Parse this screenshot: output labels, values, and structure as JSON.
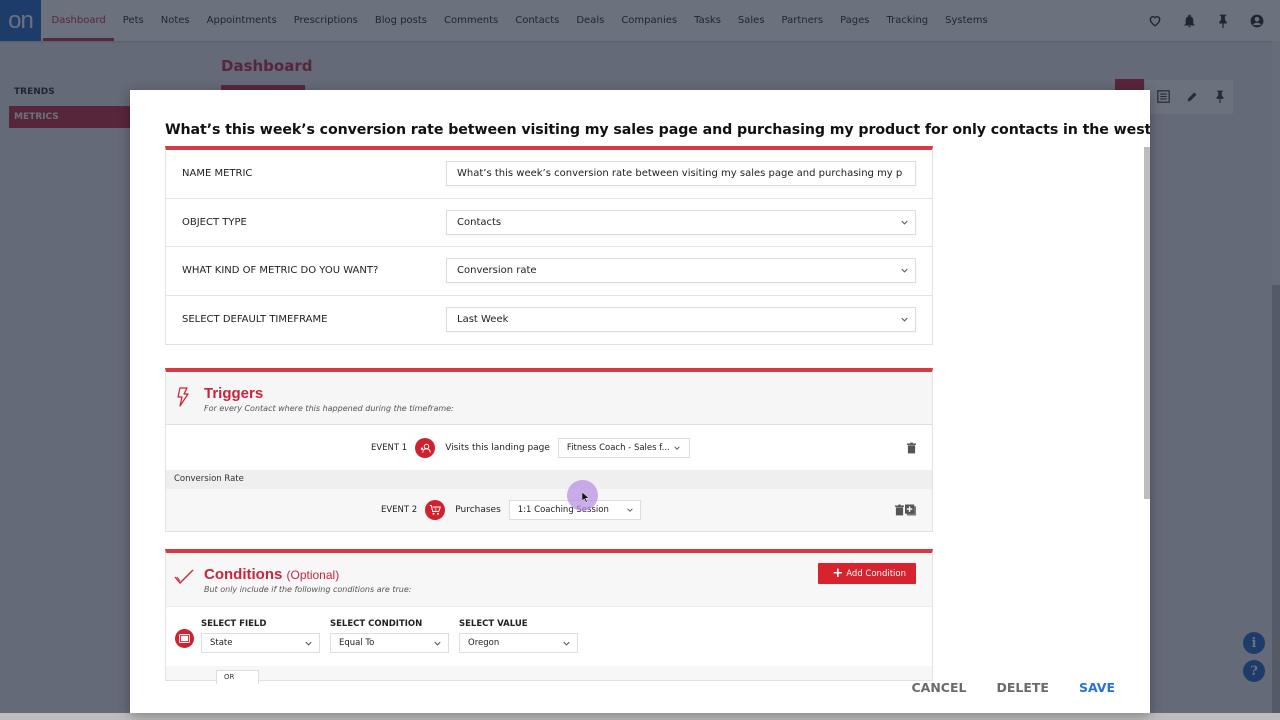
{
  "app": {
    "logo_text": "on",
    "nav": [
      {
        "label": "Dashboard",
        "active": true
      },
      {
        "label": "Pets"
      },
      {
        "label": "Notes"
      },
      {
        "label": "Appointments"
      },
      {
        "label": "Prescriptions"
      },
      {
        "label": "Blog posts"
      },
      {
        "label": "Comments"
      },
      {
        "label": "Contacts"
      },
      {
        "label": "Deals"
      },
      {
        "label": "Companies"
      },
      {
        "label": "Tasks"
      },
      {
        "label": "Sales"
      },
      {
        "label": "Partners"
      },
      {
        "label": "Pages"
      },
      {
        "label": "Tracking"
      },
      {
        "label": "Systems"
      }
    ],
    "nav_icons": [
      "heart-icon",
      "bell-icon",
      "pin-icon",
      "user-account-icon"
    ],
    "sidebar": [
      {
        "label": "TRENDS"
      },
      {
        "label": "METRICS",
        "active": true
      }
    ],
    "page_title": "Dashboard",
    "toolbar_icons": [
      "list-icon",
      "pencil-icon",
      "pin-icon"
    ],
    "help_icons": [
      "info-icon",
      "question-icon"
    ],
    "accent_color": "#c8243c",
    "link_color": "#2a73d6"
  },
  "modal": {
    "title": "What’s this week’s conversion rate between visiting my sales page and purchasing my product for only contacts in the west coast?",
    "form": {
      "name_metric": {
        "label": "NAME METRIC",
        "value": "What’s this week’s conversion rate between visiting my sales page and purchasing my p"
      },
      "object_type": {
        "label": "OBJECT TYPE",
        "value": "Contacts"
      },
      "metric_kind": {
        "label": "WHAT KIND OF METRIC DO YOU WANT?",
        "value": "Conversion rate"
      },
      "timeframe": {
        "label": "SELECT DEFAULT TIMEFRAME",
        "value": "Last Week"
      }
    },
    "triggers": {
      "title": "Triggers",
      "subtitle": "For every Contact where this happened during the timeframe:",
      "events": [
        {
          "label": "EVENT 1",
          "icon": "landing-page-visitor-icon",
          "action": "Visits this landing page",
          "value": "Fitness Coach - Sales f..."
        },
        {
          "label": "EVENT 2",
          "icon": "shopping-cart-icon",
          "action": "Purchases",
          "value": "1:1 Coaching Session"
        }
      ],
      "divider_label": "Conversion Rate"
    },
    "conditions": {
      "title": "Conditions",
      "optional": "(Optional)",
      "subtitle": "But only include if the following conditions are true:",
      "add_button": "Add Condition",
      "columns": [
        {
          "label": "SELECT FIELD",
          "value": "State"
        },
        {
          "label": "SELECT CONDITION",
          "value": "Equal To"
        },
        {
          "label": "SELECT VALUE",
          "value": "Oregon"
        }
      ],
      "joiner": "OR"
    },
    "actions": {
      "cancel": "CANCEL",
      "delete": "DELETE",
      "save": "SAVE"
    }
  }
}
